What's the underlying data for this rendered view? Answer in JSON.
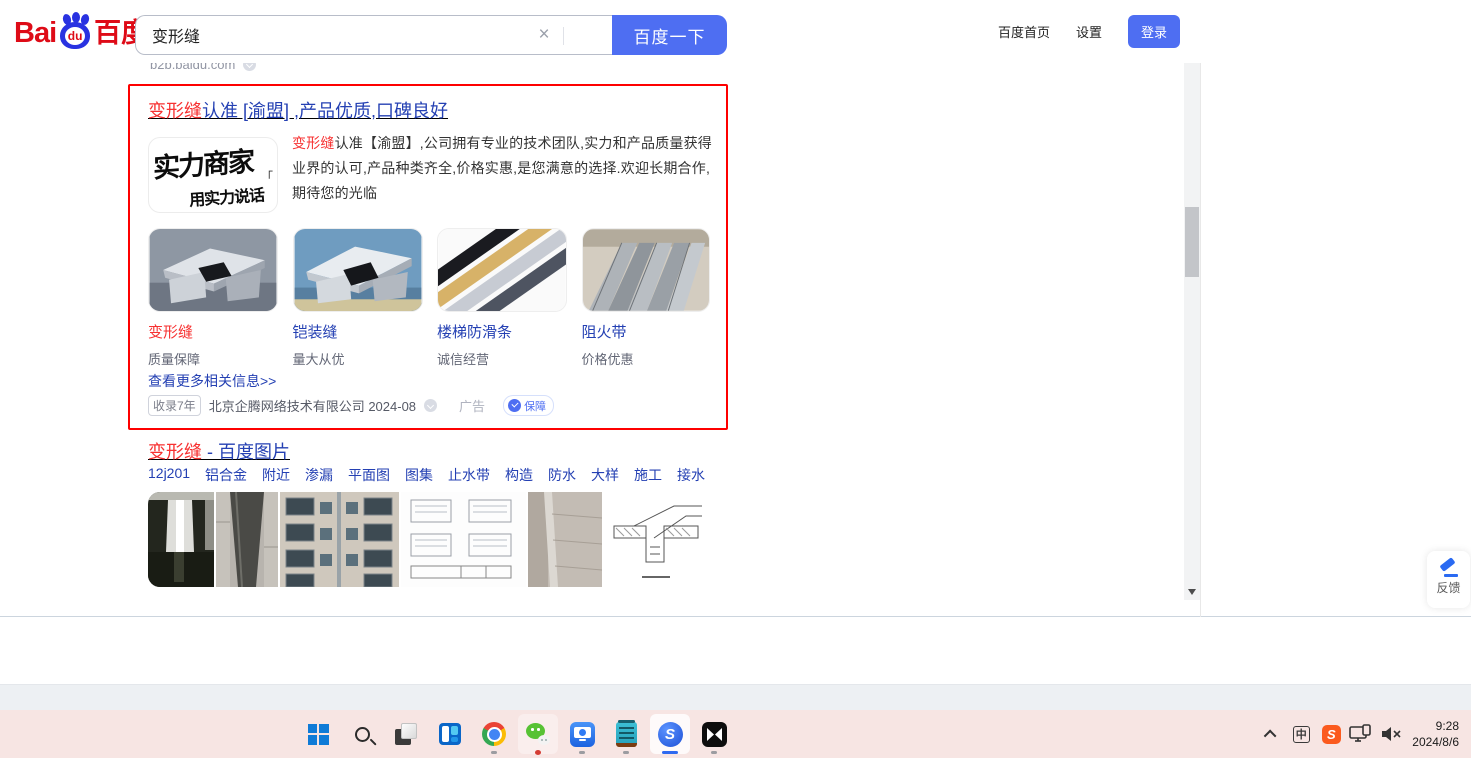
{
  "colors": {
    "accent_blue": "#4e6ef2",
    "link_blue": "#2440b3",
    "highlight_red": "#f73131",
    "annotation_box_red": "#fe0000",
    "taskbar_bg": "#f7e5e3"
  },
  "header": {
    "logo": {
      "bai": "Bai",
      "du": "du",
      "cn": "百度"
    },
    "search": {
      "value": "变形缝",
      "clear_icon": "×",
      "button_label": "百度一下"
    },
    "nav": {
      "home": "百度首页",
      "settings": "设置",
      "login": "登录"
    }
  },
  "prev_result_tail": {
    "site": "b2b.baidu.com"
  },
  "ad_result": {
    "title": {
      "highlight": "变形缝",
      "rest": "认准 [渝盟] ,产品优质,口碑良好"
    },
    "thumbnail": {
      "line1": "实力商家",
      "line2": "用实力说话",
      "quote_mark": "「"
    },
    "description": {
      "highlight": "变形缝",
      "rest": "认准【渝盟】,公司拥有专业的技术团队,实力和产品质量获得业界的认可,产品种类齐全,价格实惠,是您满意的选择.欢迎长期合作,期待您的光临"
    },
    "products": [
      {
        "name": "变形缝",
        "tagline": "质量保障"
      },
      {
        "name": "铠装缝",
        "tagline": "量大从优"
      },
      {
        "name": "楼梯防滑条",
        "tagline": "诚信经营"
      },
      {
        "name": "阻火带",
        "tagline": "价格优惠"
      }
    ],
    "more_link": "查看更多相关信息>>",
    "footer": {
      "indexed_age": "收录7年",
      "company": "北京企腾网络技术有限公司",
      "date": "2024-08",
      "ad_label": "广告",
      "guarantee_label": "保障"
    }
  },
  "images_result": {
    "title": {
      "highlight": "变形缝",
      "rest": " - 百度图片"
    },
    "tags": [
      "12j201",
      "铝合金",
      "附近",
      "渗漏",
      "平面图",
      "图集",
      "止水带",
      "构造",
      "防水",
      "大样",
      "施工",
      "接水"
    ]
  },
  "feedback": {
    "label": "反馈"
  },
  "taskbar": {
    "apps": [
      "windows-start",
      "search",
      "task-view",
      "widgets",
      "chrome",
      "wechat",
      "pc-manager",
      "notepad",
      "sogou-browser",
      "capcut"
    ],
    "app_letters": {
      "sogou": "S",
      "sogou_tray": "S",
      "ime": "中"
    },
    "tray_icons": [
      "tray-expand-chevron",
      "ime-indicator",
      "sogou-tray",
      "cast-display",
      "volume-muted"
    ],
    "clock": {
      "time": "9:28",
      "date": "2024/8/6"
    }
  }
}
